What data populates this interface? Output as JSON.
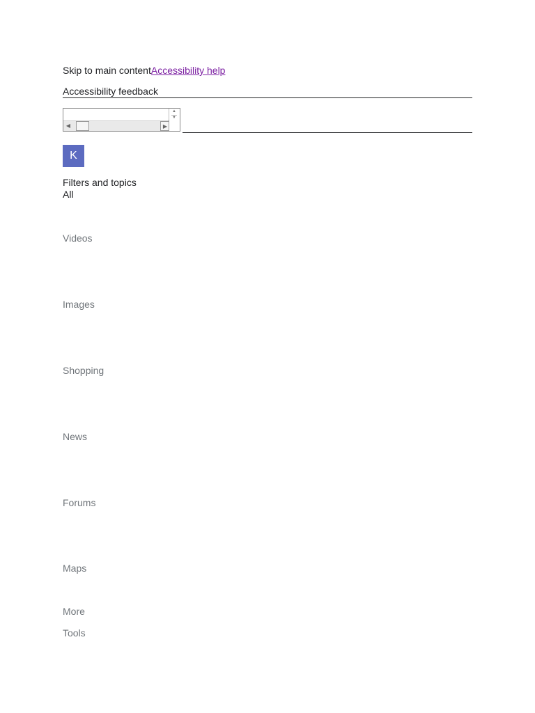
{
  "skip": {
    "main_content_label": "Skip to main content",
    "accessibility_help_label": "Accessibility help"
  },
  "feedback": {
    "label": "Accessibility feedback"
  },
  "search": {
    "value": ""
  },
  "account": {
    "avatar_letter": "K",
    "avatar_color": "#5c6bc0"
  },
  "filters": {
    "heading": "Filters and topics",
    "current": "All",
    "items": [
      {
        "label": "Videos"
      },
      {
        "label": "Images"
      },
      {
        "label": "Shopping"
      },
      {
        "label": "News"
      },
      {
        "label": "Forums"
      },
      {
        "label": "Maps"
      },
      {
        "label": "More"
      },
      {
        "label": "Tools"
      }
    ]
  },
  "colors": {
    "link_visited": "#7b1fa2",
    "muted_text": "#70757a"
  }
}
